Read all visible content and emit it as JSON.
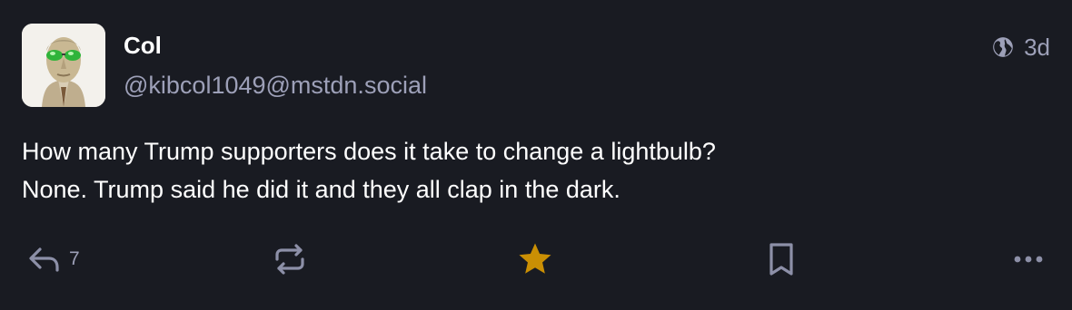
{
  "author": {
    "display_name": "Col",
    "handle": "@kibcol1049@mstdn.social",
    "avatar_icon": "avatar-image"
  },
  "meta": {
    "visibility_icon": "globe-icon",
    "relative_time": "3d"
  },
  "content": {
    "line1": "How many Trump supporters does it take to change a lightbulb?",
    "line2": "None. Trump said he did it and they all clap in the dark."
  },
  "actions": {
    "reply_icon": "reply-icon",
    "reply_count": "7",
    "boost_icon": "boost-icon",
    "favourite_icon": "star-icon",
    "favourited": true,
    "bookmark_icon": "bookmark-icon",
    "more_icon": "more-icon"
  },
  "colors": {
    "background": "#191b22",
    "secondary_text": "#9da0b8",
    "icon": "#8d90a8",
    "favourite_active": "#ca8f04"
  }
}
